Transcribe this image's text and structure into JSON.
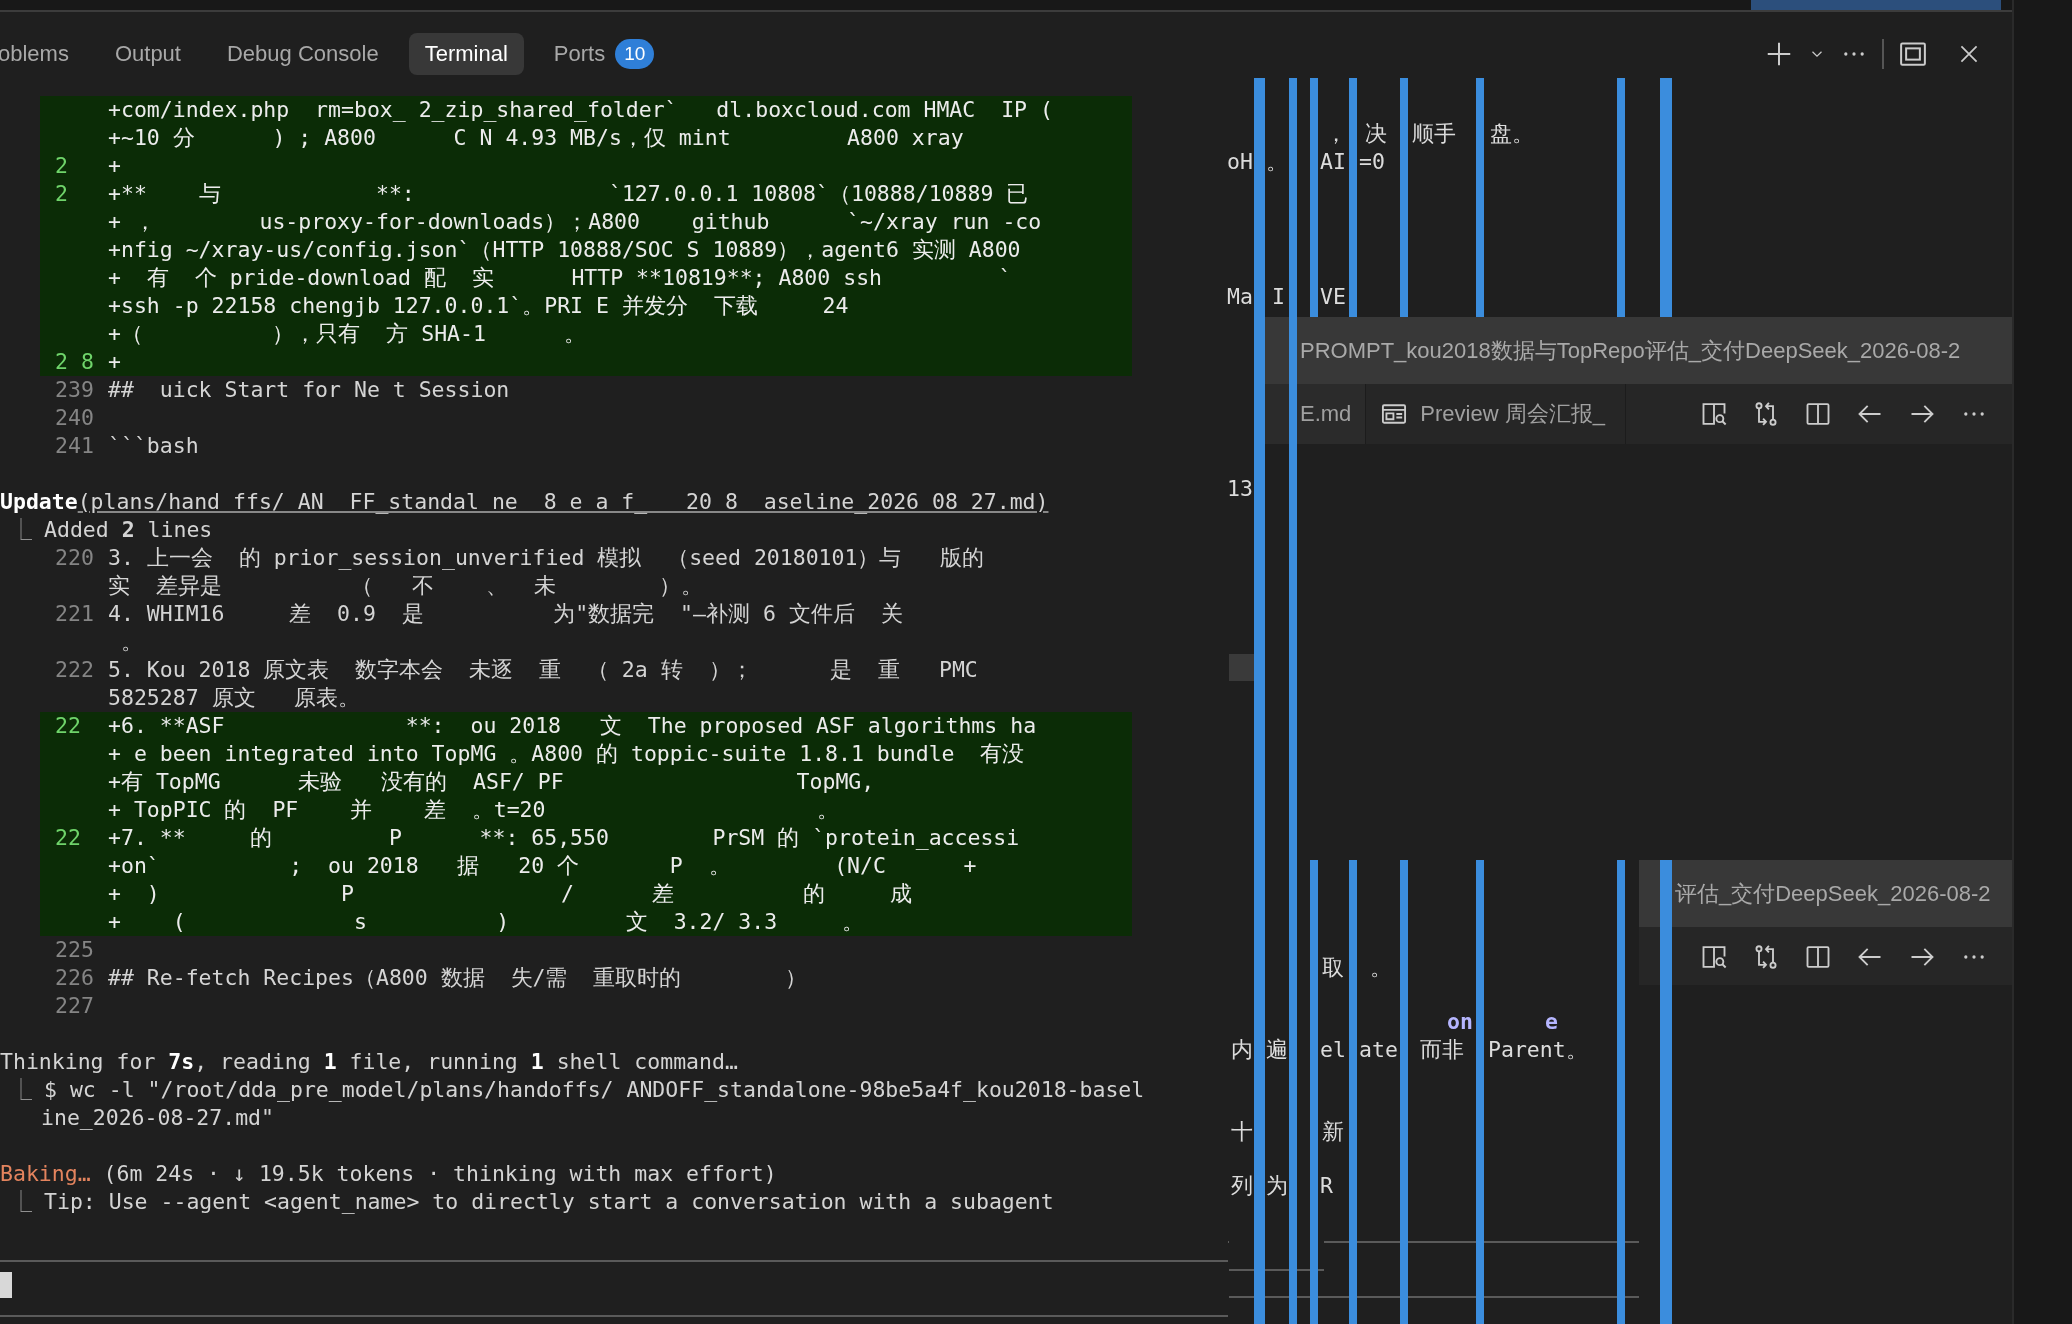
{
  "panel_tabs": [
    {
      "label": "oblems",
      "selected": false
    },
    {
      "label": "Output",
      "selected": false
    },
    {
      "label": "Debug Console",
      "selected": false
    },
    {
      "label": "Terminal",
      "selected": true
    },
    {
      "label": "Ports",
      "selected": false,
      "badge": "10"
    }
  ],
  "terminal": {
    "lines": [
      {
        "kind": "added",
        "text": "+com/index.php  rm=box_ 2_zip_shared_folder`   dl.boxcloud.com HMAC  IP ("
      },
      {
        "kind": "added",
        "text": "+~10 分      ) ; A800      C N 4.93 MB/s，仅 mint         A800 xray"
      },
      {
        "kind": "added",
        "number": "2",
        "text": "+"
      },
      {
        "kind": "added",
        "number": "2",
        "text": "+**    与            **:               `127.0.0.1 10808`（10888/10889 已"
      },
      {
        "kind": "added",
        "text": "+ ，        us-proxy-for-downloads）；A800    github      `~/xray run -co"
      },
      {
        "kind": "added",
        "text": "+nfig ~/xray-us/config.json`（HTTP 10888/SOC S 10889），agent6 实测 A800"
      },
      {
        "kind": "added",
        "text": "+  有  个 pride-download 配  实      HTTP **10819**; A800 ssh         `"
      },
      {
        "kind": "added",
        "text": "+ssh -p 22158 chengjb 127.0.0.1`。PRI E 并发分  下载     24"
      },
      {
        "kind": "added",
        "text": "+（          ），只有  方 SHA-1      。"
      },
      {
        "kind": "added",
        "number": "2 8",
        "text": "+"
      },
      {
        "kind": "context",
        "number": "239",
        "text": "##  uick Start for Ne t Session"
      },
      {
        "kind": "context",
        "number": "240"
      },
      {
        "kind": "context",
        "number": "241",
        "text": "```bash"
      },
      {
        "kind": "blank"
      },
      {
        "kind": "tool",
        "name": "Update",
        "args": "(plans/hand ffs/ AN  FF_standal ne  8 e a f_   20 8  aseline_2026 08 27.md)"
      },
      {
        "kind": "result",
        "prefix": "⎿",
        "text": "Added **2** lines"
      },
      {
        "kind": "context",
        "number": "220",
        "text": "3. 上一会  的 prior_session_unverified 模拟  （seed 20180101）与   版的"
      },
      {
        "kind": "context",
        "text": "实  差异是          （   不    、  未        ）。"
      },
      {
        "kind": "context",
        "number": "221",
        "text": "4. WHIM16     差  0.9  是          为\"数据完  \"—补测 6 文件后  关"
      },
      {
        "kind": "context",
        "text": " 。"
      },
      {
        "kind": "context",
        "number": "222",
        "text": "5. Kou 2018 原文表  数字本会  未逐  重  （ 2a 转  ）；      是  重   PMC"
      },
      {
        "kind": "context",
        "text": "5825287 原文   原表。"
      },
      {
        "kind": "added",
        "number": "22",
        "text": "+6. **ASF              **:  ou 2018   文  The proposed ASF algorithms ha"
      },
      {
        "kind": "added",
        "text": "+ e been integrated into TopMG 。A800 的 toppic-suite 1.8.1 bundle  有没"
      },
      {
        "kind": "added",
        "text": "+有 TopMG      未验   没有的  ASF/ PF                  TopMG,"
      },
      {
        "kind": "added",
        "text": "+ TopPIC 的  PF    并    差  。t=20                     。"
      },
      {
        "kind": "added",
        "number": "22",
        "text": "+7. **     的         P      **: 65,550        PrSM 的 `protein_accessi"
      },
      {
        "kind": "added",
        "text": "+on`          ;  ou 2018   据   20 个       P  。        (N/C      +"
      },
      {
        "kind": "added",
        "text": "+  )              P                /      差          的     成"
      },
      {
        "kind": "added",
        "text": "+    (             s          )         文  3.2/ 3.3     。"
      },
      {
        "kind": "context",
        "number": "225"
      },
      {
        "kind": "context",
        "number": "226",
        "text": "## Re-fetch Recipes（A800 数据  失/需  重取时的        ）"
      },
      {
        "kind": "context",
        "number": "227"
      },
      {
        "kind": "blank"
      },
      {
        "kind": "status",
        "text": "Thinking for **7s**, reading **1** file, running **1** shell command…"
      },
      {
        "kind": "result",
        "prefix": "⎿",
        "text": "$ wc -l \"/root/dda_pre_model/plans/handoffs/ ANDOFF_standalone-98be5a4f_kou2018-basel"
      },
      {
        "kind": "continuation",
        "text": "ine_2026-08-27.md\""
      },
      {
        "kind": "blank"
      },
      {
        "kind": "spinner",
        "label": "Baking…",
        "detail": "(6m 24s · ↓ 19.5k tokens · thinking with max effort)"
      },
      {
        "kind": "result",
        "prefix": "⎿",
        "text": "Tip: Use --agent <agent_name> to directly start a conversation with a subagent"
      }
    ]
  },
  "background_fragments": [
    {
      "kind": "plain",
      "text": "，"
    },
    {
      "kind": "plain",
      "text": "决"
    },
    {
      "kind": "plain",
      "text": "顺手"
    },
    {
      "kind": "plain",
      "text": "盘。"
    },
    {
      "kind": "plain",
      "text": "oH"
    },
    {
      "kind": "plain",
      "text": "。"
    },
    {
      "kind": "plain",
      "text": "AI"
    },
    {
      "kind": "plain",
      "text": "=0"
    },
    {
      "kind": "plain",
      "text": "Ma"
    },
    {
      "kind": "plain",
      "text": "I"
    },
    {
      "kind": "plain",
      "text": "VE"
    },
    {
      "kind": "plain",
      "text": "13"
    },
    {
      "kind": "plain",
      "text": "取"
    },
    {
      "kind": "plain",
      "text": "。"
    },
    {
      "kind": "highlight",
      "text": "on"
    },
    {
      "kind": "highlight",
      "text": "e"
    },
    {
      "kind": "plain",
      "text": "内"
    },
    {
      "kind": "plain",
      "text": "遍"
    },
    {
      "kind": "plain",
      "text": "el"
    },
    {
      "kind": "plain",
      "text": "ate"
    },
    {
      "kind": "plain",
      "text": "而非"
    },
    {
      "kind": "plain",
      "text": "Parent。"
    },
    {
      "kind": "plain",
      "text": "十"
    },
    {
      "kind": "plain",
      "text": "新"
    },
    {
      "kind": "plain",
      "text": "列"
    },
    {
      "kind": "plain",
      "text": "为"
    },
    {
      "kind": "plain",
      "text": "R"
    }
  ],
  "editor_groups": [
    {
      "title": "PROMPT_kou2018数据与TopRepo评估_交付DeepSeek_2026-08-2",
      "tabs": [
        {
          "kind": "file",
          "label": "E.md"
        },
        {
          "kind": "preview",
          "label": "Preview 周会汇报_"
        }
      ]
    },
    {
      "title": "评估_交付DeepSeek_2026-08-2"
    }
  ]
}
